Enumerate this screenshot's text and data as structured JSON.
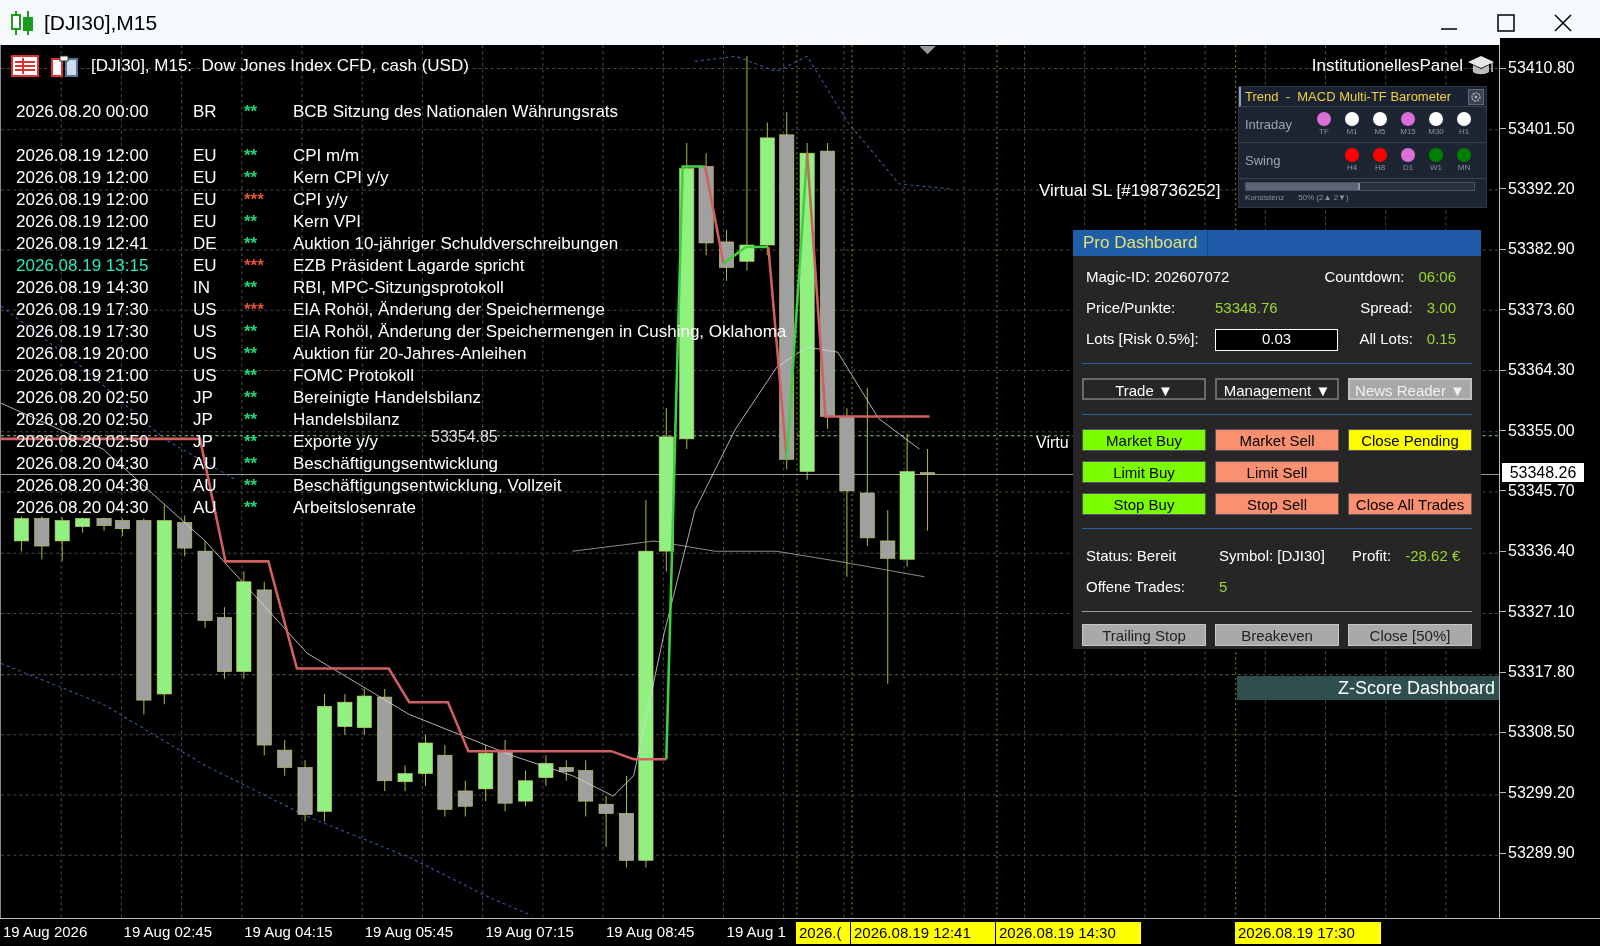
{
  "window": {
    "title": "[DJI30],M15"
  },
  "chart": {
    "header": "[DJI30], M15:  Dow Jones Index CFD, cash (USD)",
    "news_groups": [
      [
        {
          "time": "2026.08.20 00:00",
          "country": "BR",
          "stars": "**",
          "color": "#1fd67a",
          "highlighted": false,
          "event": "BCB Sitzung des Nationalen Währungsrats"
        }
      ],
      [
        {
          "time": "2026.08.19 12:00",
          "country": "EU",
          "stars": "**",
          "color": "#1fd67a",
          "highlighted": false,
          "event": "CPI m/m"
        },
        {
          "time": "2026.08.19 12:00",
          "country": "EU",
          "stars": "**",
          "color": "#1fd67a",
          "highlighted": false,
          "event": "Kern CPI y/y"
        },
        {
          "time": "2026.08.19 12:00",
          "country": "EU",
          "stars": "***",
          "color": "#e0553a",
          "highlighted": false,
          "event": "CPI y/y"
        },
        {
          "time": "2026.08.19 12:00",
          "country": "EU",
          "stars": "**",
          "color": "#1fd67a",
          "highlighted": false,
          "event": "Kern VPI"
        },
        {
          "time": "2026.08.19 12:41",
          "country": "DE",
          "stars": "**",
          "color": "#1fd67a",
          "highlighted": false,
          "event": "Auktion 10-jähriger Schuldverschreibungen"
        },
        {
          "time": "2026.08.19 13:15",
          "country": "EU",
          "stars": "***",
          "color": "#e0553a",
          "highlighted": true,
          "event": "EZB Präsident Lagarde spricht"
        },
        {
          "time": "2026.08.19 14:30",
          "country": "IN",
          "stars": "**",
          "color": "#1fd67a",
          "highlighted": false,
          "event": "RBI, MPC-Sitzungsprotokoll"
        },
        {
          "time": "2026.08.19 17:30",
          "country": "US",
          "stars": "***",
          "color": "#e0553a",
          "highlighted": false,
          "event": "EIA Rohöl, Änderung der Speichermenge"
        },
        {
          "time": "2026.08.19 17:30",
          "country": "US",
          "stars": "**",
          "color": "#1fd67a",
          "highlighted": false,
          "event": "EIA Rohöl, Änderung der Speichermengen in Cushing, Oklahoma"
        },
        {
          "time": "2026.08.19 20:00",
          "country": "US",
          "stars": "**",
          "color": "#1fd67a",
          "highlighted": false,
          "event": "Auktion für 20-Jahres-Anleihen"
        },
        {
          "time": "2026.08.19 21:00",
          "country": "US",
          "stars": "**",
          "color": "#1fd67a",
          "highlighted": false,
          "event": "FOMC Protokoll"
        },
        {
          "time": "2026.08.20 02:50",
          "country": "JP",
          "stars": "**",
          "color": "#1fd67a",
          "highlighted": false,
          "event": "Bereinigte Handelsbilanz"
        },
        {
          "time": "2026.08.20 02:50",
          "country": "JP",
          "stars": "**",
          "color": "#1fd67a",
          "highlighted": false,
          "event": "Handelsbilanz"
        },
        {
          "time": "2026.08.20 02:50",
          "country": "JP",
          "stars": "**",
          "color": "#1fd67a",
          "highlighted": false,
          "event": "Exporte y/y"
        },
        {
          "time": "2026.08.20 04:30",
          "country": "AU",
          "stars": "**",
          "color": "#1fd67a",
          "highlighted": false,
          "event": "Beschäftigungsentwicklung"
        },
        {
          "time": "2026.08.20 04:30",
          "country": "AU",
          "stars": "**",
          "color": "#1fd67a",
          "highlighted": false,
          "event": "Beschäftigungsentwicklung, Vollzeit"
        },
        {
          "time": "2026.08.20 04:30",
          "country": "AU",
          "stars": "**",
          "color": "#1fd67a",
          "highlighted": false,
          "event": "Arbeitslosenrate"
        }
      ]
    ],
    "level_label": "53354.85",
    "virtual_sl": "Virtual SL [#198736252]",
    "virtual_sl_cut": "Virtu",
    "panel_title": "InstitutionellesPanel"
  },
  "barometer": {
    "title": "Trend  -  MACD Multi-TF Barometer",
    "rows": [
      {
        "label": "Intraday",
        "dots": [
          {
            "tf": "TF",
            "color": "#da70d6"
          },
          {
            "tf": "M1",
            "color": "#ffffff"
          },
          {
            "tf": "M5",
            "color": "#ffffff"
          },
          {
            "tf": "M15",
            "color": "#da70d6"
          },
          {
            "tf": "M30",
            "color": "#ffffff"
          },
          {
            "tf": "H1",
            "color": "#ffffff"
          }
        ]
      },
      {
        "label": "Swing",
        "dots": [
          {
            "tf": "H4",
            "color": "#ff0000"
          },
          {
            "tf": "H8",
            "color": "#ff0000"
          },
          {
            "tf": "D1",
            "color": "#da70d6"
          },
          {
            "tf": "W1",
            "color": "#008000"
          },
          {
            "tf": "MN",
            "color": "#008000"
          }
        ]
      }
    ],
    "consistency": {
      "label": "Konsistenz",
      "reading": "50% (2▲ 2▼)",
      "level": 0.5
    }
  },
  "dashboard": {
    "title": "Pro Dashboard",
    "info_rows": [
      [
        {
          "label": "Magic-ID: 202607072"
        },
        {
          "label": "Countdown:",
          "value": "06:06"
        }
      ],
      [
        {
          "label": "Price/Punkte:",
          "value": "53348.76"
        },
        {
          "label": "Spread:",
          "value": "3.00"
        }
      ],
      [
        {
          "label": "Lots [Risk 0.5%]:",
          "input": "0.03"
        },
        {
          "label": "All Lots:",
          "value": "0.15"
        }
      ]
    ],
    "menus": [
      {
        "label": "Trade ▼",
        "active": false
      },
      {
        "label": "Management ▼",
        "active": false
      },
      {
        "label": "News Reader ▼",
        "active": true
      }
    ],
    "action_rows": [
      [
        {
          "label": "Market Buy",
          "kind": "buy"
        },
        {
          "label": "Market Sell",
          "kind": "sell"
        },
        {
          "label": "Close Pending",
          "kind": "pending"
        }
      ],
      [
        {
          "label": "Limit Buy",
          "kind": "buy"
        },
        {
          "label": "Limit Sell",
          "kind": "sell"
        }
      ],
      [
        {
          "label": "Stop Buy",
          "kind": "buy"
        },
        {
          "label": "Stop Sell",
          "kind": "sell"
        },
        {
          "label": "Close All Trades",
          "kind": "sell"
        }
      ]
    ],
    "status_rows": [
      [
        {
          "label": "Status: Bereit"
        },
        {
          "label": "Symbol: [DJI30]"
        },
        {
          "label": "Profit:",
          "value": "-28.62 €"
        }
      ],
      [
        {
          "label": "Offene Trades:",
          "value": "5"
        }
      ]
    ],
    "bottom_buttons": [
      "Trailing Stop",
      "Breakeven",
      "Close [50%]"
    ]
  },
  "zscore": {
    "title": "Z-Score Dashboard"
  },
  "price_axis": {
    "labels": [
      "53410.80",
      "53401.50",
      "53392.20",
      "53382.90",
      "53373.60",
      "53364.30",
      "53355.00",
      "53345.70",
      "53336.40",
      "53327.10",
      "53317.80",
      "53308.50",
      "53299.20",
      "53289.90"
    ],
    "current": "53348.26"
  },
  "time_axis": {
    "labels": [
      "19 Aug 2026",
      "19 Aug 02:45",
      "19 Aug 04:15",
      "19 Aug 05:45",
      "19 Aug 07:15",
      "19 Aug 08:45",
      "19 Aug 1"
    ],
    "events": [
      "2026.(",
      "2026.08.19 12:41",
      "2026.08.19 14:30",
      "2026.08.19 17:30"
    ]
  }
}
